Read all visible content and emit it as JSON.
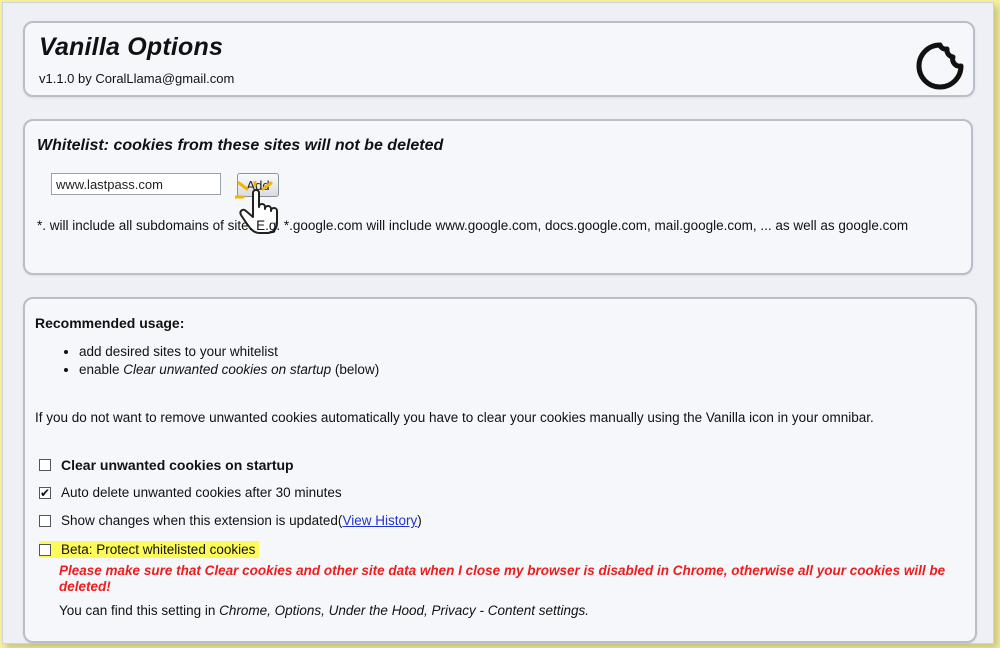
{
  "header": {
    "title": "Vanilla Options",
    "version": "v1.1.0 by CoralLlama@gmail.com",
    "logo_icon": "cookie-icon"
  },
  "whitelist": {
    "heading": "Whitelist: cookies from these sites will not be deleted",
    "input_value": "www.lastpass.com",
    "add_label": "Add",
    "note": "*. will include all subdomains of site. E.g. *.google.com will include www.google.com, docs.google.com, mail.google.com, ... as well as google.com"
  },
  "recommended": {
    "heading": "Recommended usage:",
    "items": [
      {
        "text": "add desired sites to your whitelist"
      },
      {
        "pre": "enable ",
        "em": "Clear unwanted cookies on startup",
        "post": " (below)"
      }
    ],
    "note": "If you do not want to remove unwanted cookies automatically you have to clear your cookies manually using the Vanilla icon in your omnibar."
  },
  "options": [
    {
      "label": "Clear unwanted cookies on startup",
      "checked": false
    },
    {
      "label": "Auto delete unwanted cookies after 30 minutes",
      "checked": true
    },
    {
      "label": "Show changes when this extension is updated(",
      "link": "View History",
      "after": ")",
      "checked": false
    },
    {
      "label": "Beta: Protect whitelisted cookies",
      "checked": false
    }
  ],
  "warning": {
    "pre": "Please make sure that ",
    "em": "Clear cookies and other site data when I close my browser",
    "post": " is disabled in Chrome, otherwise all your cookies will be deleted!"
  },
  "setting_note": {
    "pre": "You can find this setting in ",
    "em": "Chrome, Options, Under the Hood, Privacy - Content settings."
  },
  "colors": {
    "background": "#f7ef9c",
    "warning": "#ee1c1c",
    "highlight": "#fdfb5c",
    "link": "#2233cc"
  }
}
